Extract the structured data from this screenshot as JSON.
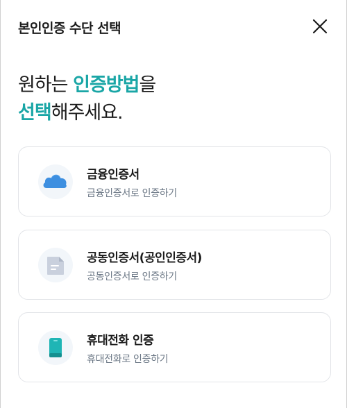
{
  "header": {
    "title": "본인인증 수단 선택",
    "close_icon": "close-icon"
  },
  "headline": {
    "line1_prefix": "원하는 ",
    "line1_highlight": "인증방법",
    "line1_suffix": "을",
    "line2_highlight": "선택",
    "line2_suffix": "해주세요."
  },
  "colors": {
    "accent": "#1aa6a6",
    "card_border": "#e2e4e8",
    "subtext": "#6b7785"
  },
  "methods": [
    {
      "icon": "cloud-icon",
      "title": "금융인증서",
      "subtitle": "금융인증서로 인증하기"
    },
    {
      "icon": "document-icon",
      "title": "공동인증서(공인인증서)",
      "subtitle": "공동인증서로 인증하기"
    },
    {
      "icon": "phone-icon",
      "title": "휴대전화 인증",
      "subtitle": "휴대전화로 인증하기"
    }
  ]
}
